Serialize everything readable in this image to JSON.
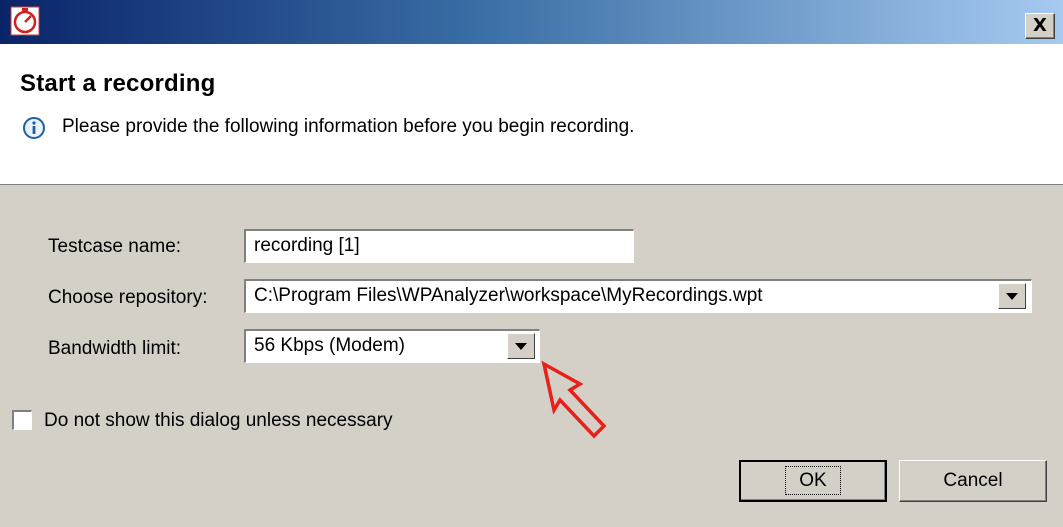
{
  "window": {
    "close_label": "X",
    "icon": "stopwatch-icon"
  },
  "header": {
    "title": "Start a recording",
    "message": "Please provide the following information before you begin recording.",
    "info_icon": "info-icon"
  },
  "form": {
    "testcase_label": "Testcase name:",
    "testcase_value": "recording [1]",
    "repository_label": "Choose repository:",
    "repository_value": "C:\\Program Files\\WPAnalyzer\\workspace\\MyRecordings.wpt",
    "bandwidth_label": "Bandwidth limit:",
    "bandwidth_value": "56 Kbps (Modem)"
  },
  "options": {
    "dont_show_label": "Do not show this dialog unless necessary",
    "dont_show_checked": false
  },
  "buttons": {
    "ok_label": "OK",
    "cancel_label": "Cancel"
  },
  "annotation": {
    "arrow_color": "#e8201a"
  }
}
